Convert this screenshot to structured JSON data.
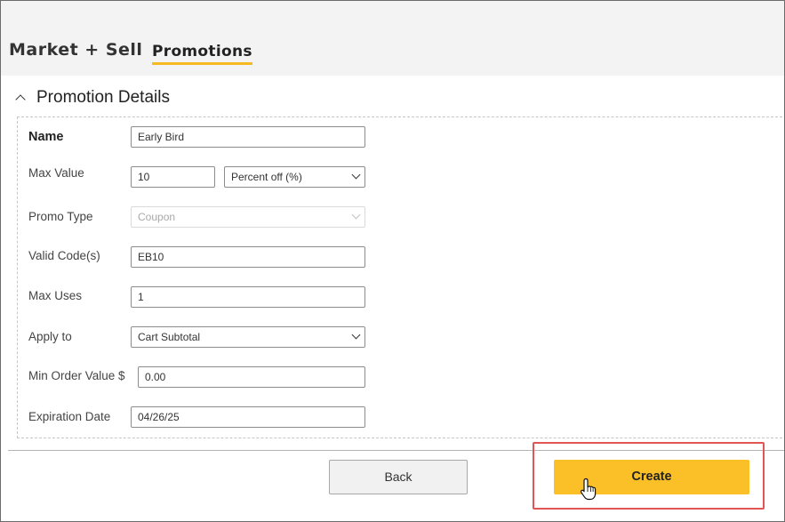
{
  "nav": {
    "title": "Market + Sell",
    "active_tab": "Promotions"
  },
  "section": {
    "title": "Promotion Details",
    "icon": "chevron-up-icon"
  },
  "form": {
    "name": {
      "label": "Name",
      "value": "Early Bird"
    },
    "max_value": {
      "label": "Max Value",
      "value": "10",
      "unit_selected": "Percent off (%)"
    },
    "promo_type": {
      "label": "Promo Type",
      "selected": "Coupon",
      "disabled": true
    },
    "valid_codes": {
      "label": "Valid Code(s)",
      "value": "EB10"
    },
    "max_uses": {
      "label": "Max Uses",
      "value": "1"
    },
    "apply_to": {
      "label": "Apply to",
      "selected": "Cart Subtotal"
    },
    "min_order_value": {
      "label": "Min Order Value $",
      "value": "0.00"
    },
    "expiration_date": {
      "label": "Expiration Date",
      "value": "04/26/25"
    }
  },
  "actions": {
    "back_label": "Back",
    "create_label": "Create"
  },
  "colors": {
    "accent": "#fbbf28",
    "tab_underline": "#f5b921",
    "highlight": "#e05656"
  }
}
